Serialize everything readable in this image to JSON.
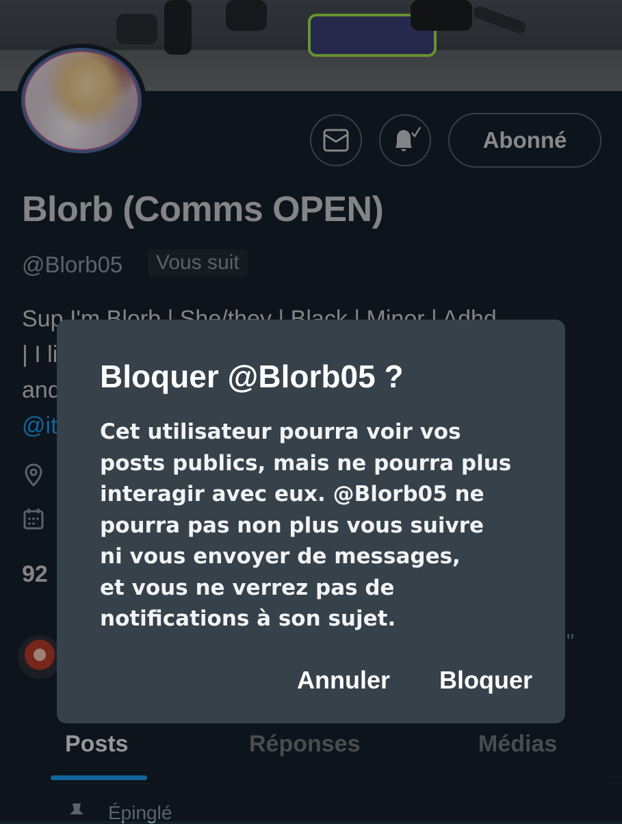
{
  "profile": {
    "name": "Blorb (Comms OPEN)",
    "handle": "@Blorb05",
    "follows_you_badge": "Vous suit",
    "follow_button_label": "Abonné",
    "bio_lines": [
      "Sup I'm Blorb | She/they | Black | Minor | Adhd",
      "| I li",
      "and",
      "@it"
    ],
    "following_count_partial": "92",
    "follower_preview_text": "h\""
  },
  "icons": {
    "message": "envelope-icon",
    "notifications": "bell-check-icon",
    "location": "location-pin-icon",
    "joined": "calendar-icon",
    "pinned": "pin-icon"
  },
  "tabs": [
    {
      "label": "Posts",
      "active": true
    },
    {
      "label": "Réponses",
      "active": false
    },
    {
      "label": "Médias",
      "active": false
    }
  ],
  "pinned_label": "Épinglé",
  "dialog": {
    "title": "Bloquer @Blorb05 ?",
    "body_lines": [
      "Cet utilisateur pourra voir vos",
      "posts publics, mais ne pourra plus",
      "interagir avec eux. @Blorb05 ne",
      "pourra pas non plus vous suivre",
      "ni vous envoyer de messages,",
      "et vous ne verrez pas de",
      "notifications à son sujet."
    ],
    "cancel_label": "Annuler",
    "confirm_label": "Bloquer"
  },
  "colors": {
    "background": "#15202b",
    "dialog_background": "#36414a",
    "accent": "#1d9bf0",
    "muted_text": "#8b98a5"
  }
}
